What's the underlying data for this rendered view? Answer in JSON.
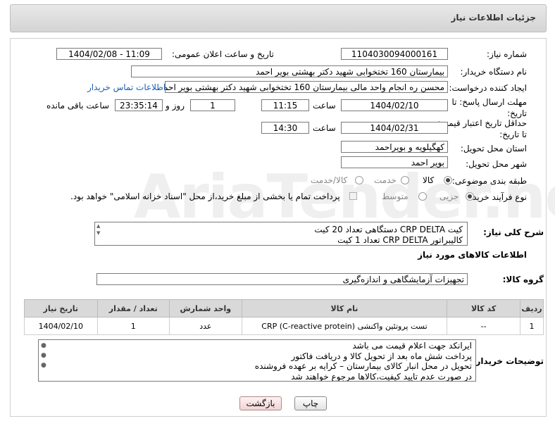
{
  "header": {
    "title": "جزئیات اطلاعات نیاز"
  },
  "form": {
    "need_number_label": "شماره نیاز:",
    "need_number": "1104030094000161",
    "announce_label": "تاریخ و ساعت اعلان عمومی:",
    "announce_value": "1404/02/08 - 11:09",
    "buyer_label": "نام دستگاه خریدار:",
    "buyer_value": "بیمارستان 160 تختخوابی شهید دکتر بهشتی بویر احمد",
    "creator_label": "ایجاد کننده درخواست:",
    "creator_value": "محسن ره انجام واحد مالی بیمارستان 160 تختخوابی شهید دکتر بهشتی بویر احمد",
    "contact_link": "اطلاعات تماس خریدار",
    "deadline_label": "مهلت ارسال پاسخ: تا تاریخ:",
    "deadline_date": "1404/02/10",
    "time_label": "ساعت",
    "deadline_time": "11:15",
    "days_value": "1",
    "days_label": "روز و",
    "remaining_time": "23:35:14",
    "remaining_label": "ساعت باقی مانده",
    "validity_label": "حداقل تاریخ اعتبار قیمت: تا تاریخ:",
    "validity_date": "1404/02/31",
    "validity_time": "14:30",
    "province_label": "استان محل تحویل:",
    "province_value": "کهگیلویه و بویراحمد",
    "city_label": "شهر محل تحویل:",
    "city_value": "بویر احمد",
    "category_label": "طبقه بندی موضوعی:",
    "category_options": [
      "کالا",
      "خدمت",
      "کالا/خدمت"
    ],
    "category_selected": "کالا",
    "process_label": "نوع فرآیند خرید :",
    "process_options": [
      "جزیی",
      "متوسط"
    ],
    "process_selected": "جزیی",
    "payment_note": "پرداخت تمام یا بخشی از مبلغ خرید،از محل \"اسناد خزانه اسلامی\" خواهد بود."
  },
  "description": {
    "label": "شرح کلی نیاز:",
    "line1": "کیت  CRP DELTA دستگاهی تعداد 20 کیت",
    "line2": "کالیبراتور  CRP DELTA   تعداد 1 کیت"
  },
  "goods_info_title": "اطلاعات کالاهای مورد نیاز",
  "goods_group": {
    "label": "گروه کالا:",
    "value": "تجهیزات آزمایشگاهی و اندازه‌گیری"
  },
  "table": {
    "headers": [
      "ردیف",
      "کد کالا",
      "نام کالا",
      "واحد شمارش",
      "تعداد / مقدار",
      "تاریخ نیاز"
    ],
    "rows": [
      [
        "1",
        "--",
        "تست پروتئین واکنشی (CRP (C-reactive protein",
        "عدد",
        "1",
        "1404/02/10"
      ]
    ]
  },
  "buyer_notes": {
    "label": "توضیحات خریدار:",
    "lines": [
      "ایرانکد جهت اعلام قیمت می باشد",
      "پرداخت شش ماه بعد از تحویل کالا و دریافت فاکتور",
      "تحویل در محل انبار کالای بیمارستان – کرایه بر عهده فروشنده",
      "در صورت عدم تایید کیفیت،کالاها مرجوع خواهند شد"
    ]
  },
  "buttons": {
    "print": "چاپ",
    "back": "بازگشت"
  },
  "watermark": "AriaTender.net"
}
